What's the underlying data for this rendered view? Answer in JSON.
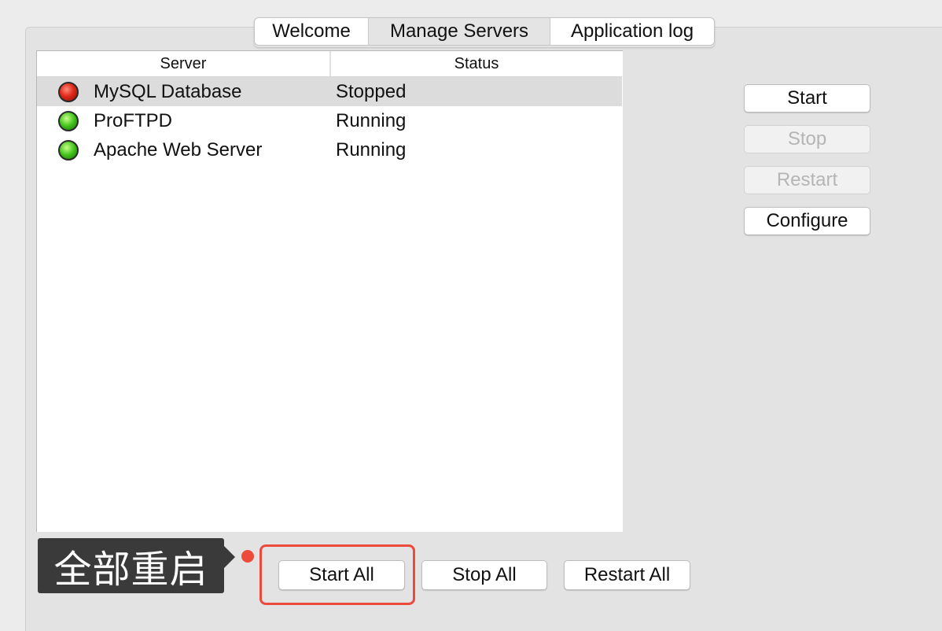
{
  "tabs": [
    {
      "label": "Welcome"
    },
    {
      "label": "Manage Servers"
    },
    {
      "label": "Application log"
    }
  ],
  "table": {
    "columns": [
      "Server",
      "Status"
    ],
    "rows": [
      {
        "name": "MySQL Database",
        "status": "Stopped",
        "indicator": "red",
        "selected": true
      },
      {
        "name": "ProFTPD",
        "status": "Running",
        "indicator": "green",
        "selected": false
      },
      {
        "name": "Apache Web Server",
        "status": "Running",
        "indicator": "green",
        "selected": false
      }
    ]
  },
  "side_buttons": {
    "start": "Start",
    "stop": "Stop",
    "restart": "Restart",
    "configure": "Configure"
  },
  "bottom_buttons": {
    "start_all": "Start All",
    "stop_all": "Stop All",
    "restart_all": "Restart All"
  },
  "annotation": {
    "callout_text": "全部重启",
    "highlight_color": "#ec4b3c"
  },
  "colors": {
    "status_stopped": "#e02a1a",
    "status_running": "#3fc21a",
    "callout_bg": "#3a3a3a"
  }
}
